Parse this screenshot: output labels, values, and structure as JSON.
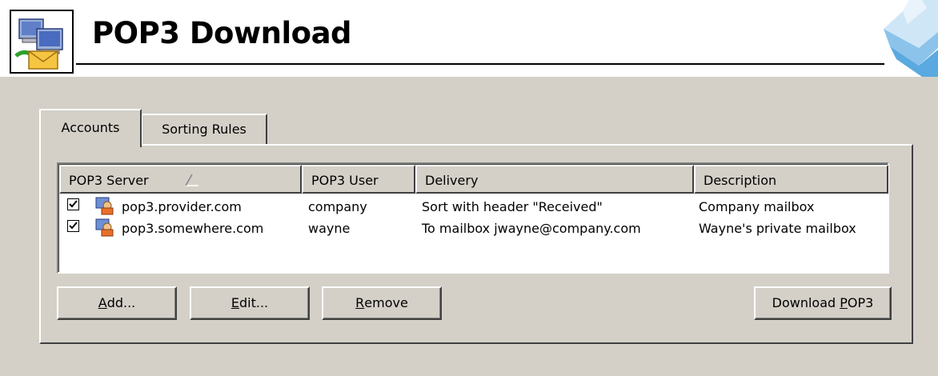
{
  "header": {
    "title": "POP3 Download",
    "app_icon": "pop3-network-mail-icon",
    "brand_logo": "blue-diamond-logo-icon"
  },
  "tabs": [
    {
      "label": "Accounts",
      "selected": true
    },
    {
      "label": "Sorting Rules",
      "selected": false
    }
  ],
  "accounts_list": {
    "columns": [
      {
        "label": "POP3 Server",
        "sorted": "ascending"
      },
      {
        "label": "POP3 User"
      },
      {
        "label": "Delivery"
      },
      {
        "label": "Description"
      }
    ],
    "rows": [
      {
        "checked": true,
        "server": "pop3.provider.com",
        "user": "company",
        "delivery": "Sort with header \"Received\"",
        "description": "Company mailbox"
      },
      {
        "checked": true,
        "server": "pop3.somewhere.com",
        "user": "wayne",
        "delivery": "To mailbox jwayne@company.com",
        "description": "Wayne's private mailbox"
      }
    ]
  },
  "buttons": {
    "add": {
      "mnemonic": "A",
      "rest": "dd..."
    },
    "edit": {
      "mnemonic": "E",
      "rest": "dit..."
    },
    "remove": {
      "mnemonic": "R",
      "rest": "emove"
    },
    "download": {
      "prefix": "Download ",
      "mnemonic": "P",
      "rest": "OP3"
    }
  },
  "colors": {
    "dialog_face": "#d4d0c8",
    "logo_blue": "#5aa9e0"
  }
}
